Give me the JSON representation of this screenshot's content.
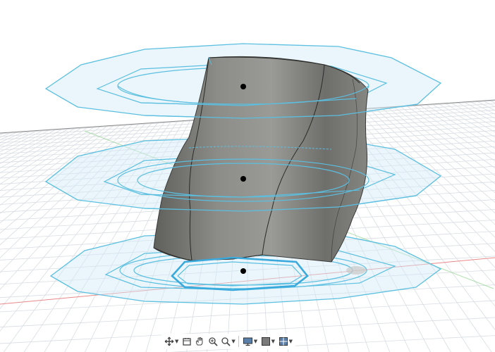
{
  "viewport": {
    "background": "#ffffff",
    "grid_color": "#d8dde2",
    "axis_red": "#e88a8a",
    "axis_green": "#8fd28f",
    "horizon_color": "#8a8a8a"
  },
  "model": {
    "body_color": "#7d7d7a",
    "sketch_color": "#5bbfe0",
    "sketch_fill": "rgba(210,236,248,0.45)",
    "highlight_color": "#3aa9dc"
  },
  "toolbar": {
    "items": [
      {
        "name": "orbit-icon",
        "has_menu": true
      },
      {
        "name": "look-at-icon",
        "has_menu": false
      },
      {
        "name": "pan-icon",
        "has_menu": false
      },
      {
        "name": "zoom-icon",
        "has_menu": false
      },
      {
        "name": "fit-icon",
        "has_menu": true
      },
      {
        "name": "display-settings-icon",
        "has_menu": true
      },
      {
        "name": "grid-snap-icon",
        "has_menu": true
      },
      {
        "name": "viewports-icon",
        "has_menu": true
      }
    ]
  }
}
